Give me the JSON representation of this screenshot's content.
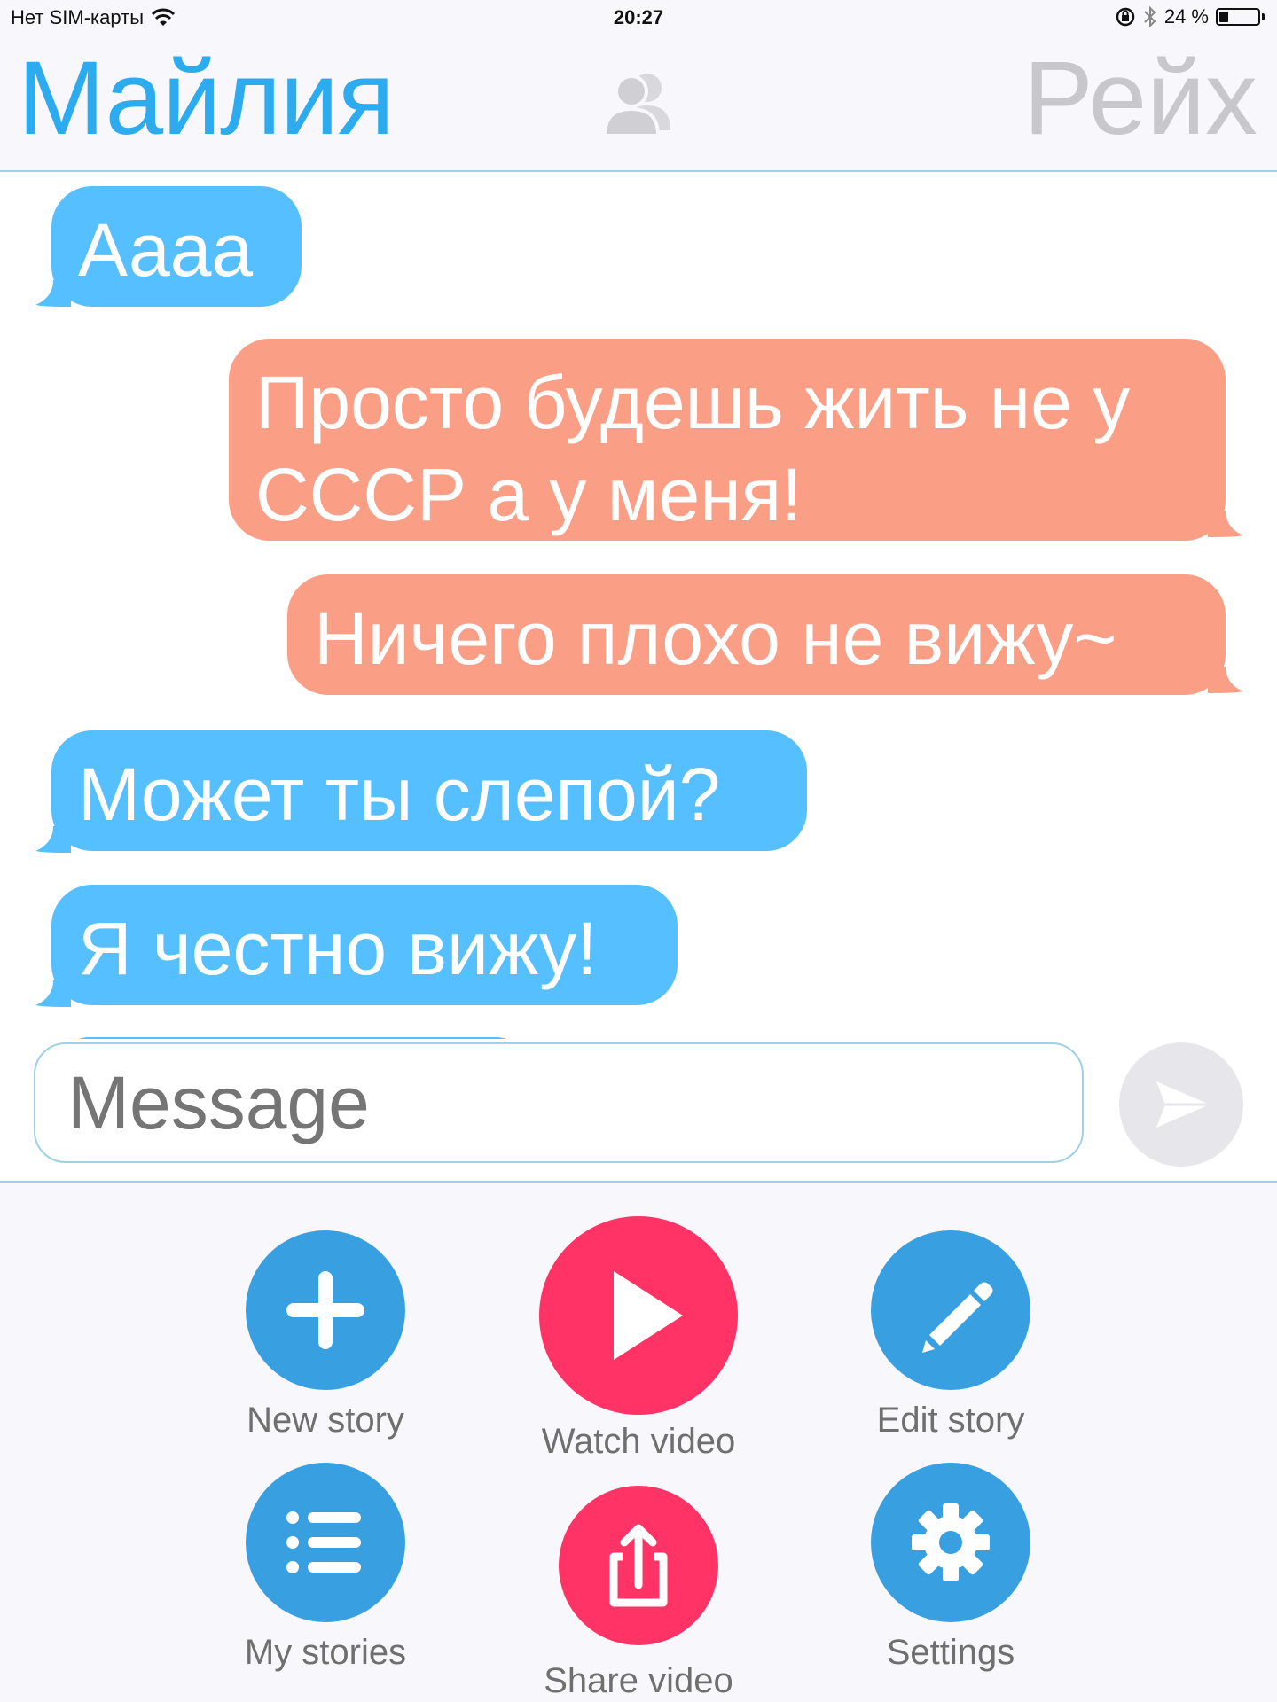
{
  "status_bar": {
    "carrier": "Нет SIM-карты",
    "time": "20:27",
    "battery_text": "24 %",
    "battery_level": 0.24
  },
  "header": {
    "left_name": "Майлия",
    "right_name": "Рейх"
  },
  "messages": [
    {
      "side": "in",
      "text": "Аааа"
    },
    {
      "side": "out",
      "text": "Просто будешь жить не у СССР а у меня!"
    },
    {
      "side": "out",
      "text": "Ничего плохо не вижу~"
    },
    {
      "side": "in",
      "text": "Может ты слепой?"
    },
    {
      "side": "in",
      "text": "Я честно вижу!"
    }
  ],
  "input": {
    "placeholder": "Message"
  },
  "menu": {
    "new_story": "New story",
    "watch_video": "Watch video",
    "edit_story": "Edit story",
    "my_stories": "My stories",
    "share_video": "Share video",
    "settings": "Settings"
  },
  "colors": {
    "accent_blue": "#2cabef",
    "incoming_bubble": "#55bfff",
    "outgoing_bubble": "#fb9e86",
    "menu_blue": "#38a0e0",
    "menu_red": "#ff3366"
  }
}
